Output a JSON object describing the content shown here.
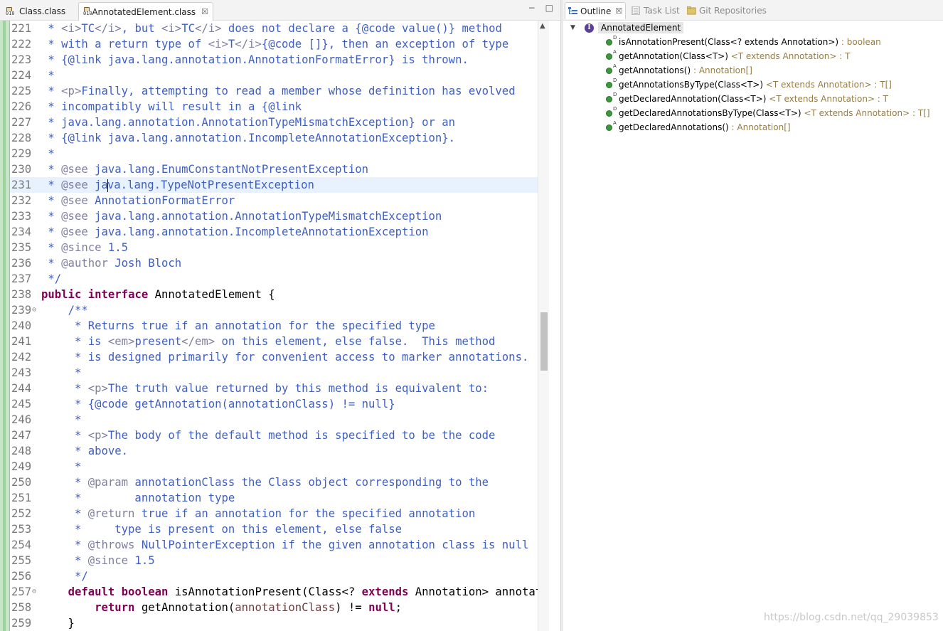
{
  "editor": {
    "tabs": [
      {
        "label": "Class.class",
        "icon": "class-file-icon"
      },
      {
        "label": "AnnotatedElement.class",
        "icon": "class-file-icon",
        "close": "☒"
      }
    ],
    "window_controls": {
      "minimize": "−",
      "maximize": "□"
    },
    "lines": [
      {
        "n": "221",
        "s": [
          [
            "cm",
            " * "
          ],
          [
            "tg",
            "<i>"
          ],
          [
            "cm",
            "TC"
          ],
          [
            "tg",
            "</i>"
          ],
          [
            "cm",
            ", but "
          ],
          [
            "tg",
            "<i>"
          ],
          [
            "cm",
            "TC"
          ],
          [
            "tg",
            "</i>"
          ],
          [
            "cm",
            " does not declare a {@code value()} method"
          ]
        ]
      },
      {
        "n": "222",
        "s": [
          [
            "cm",
            " * with a return type of "
          ],
          [
            "tg",
            "<i>"
          ],
          [
            "cm",
            "T"
          ],
          [
            "tg",
            "</i>"
          ],
          [
            "cm",
            "{@code []}, then an exception of type"
          ]
        ]
      },
      {
        "n": "223",
        "s": [
          [
            "cm",
            " * {@link java.lang.annotation.AnnotationFormatError} is thrown."
          ]
        ]
      },
      {
        "n": "224",
        "s": [
          [
            "cm",
            " *"
          ]
        ]
      },
      {
        "n": "225",
        "s": [
          [
            "cm",
            " * "
          ],
          [
            "tg",
            "<p>"
          ],
          [
            "cm",
            "Finally, attempting to read a member whose definition has evolved"
          ]
        ]
      },
      {
        "n": "226",
        "s": [
          [
            "cm",
            " * incompatibly will result in a {@link"
          ]
        ]
      },
      {
        "n": "227",
        "s": [
          [
            "cm",
            " * java.lang.annotation.AnnotationTypeMismatchException} or an"
          ]
        ]
      },
      {
        "n": "228",
        "s": [
          [
            "cm",
            " * {@link java.lang.annotation.IncompleteAnnotationException}."
          ]
        ]
      },
      {
        "n": "229",
        "s": [
          [
            "cm",
            " *"
          ]
        ]
      },
      {
        "n": "230",
        "s": [
          [
            "cm",
            " * "
          ],
          [
            "tg",
            "@see"
          ],
          [
            "cm",
            " java.lang.EnumConstantNotPresentException"
          ]
        ]
      },
      {
        "n": "231",
        "hl": true,
        "caret": true,
        "s": [
          [
            "cm",
            " * "
          ],
          [
            "tg",
            "@see"
          ],
          [
            "cm",
            " ja"
          ],
          [
            "caret",
            ""
          ],
          [
            "cm",
            "va.lang.TypeNotPresentException"
          ]
        ]
      },
      {
        "n": "232",
        "s": [
          [
            "cm",
            " * "
          ],
          [
            "tg",
            "@see"
          ],
          [
            "cm",
            " AnnotationFormatError"
          ]
        ]
      },
      {
        "n": "233",
        "s": [
          [
            "cm",
            " * "
          ],
          [
            "tg",
            "@see"
          ],
          [
            "cm",
            " java.lang.annotation.AnnotationTypeMismatchException"
          ]
        ]
      },
      {
        "n": "234",
        "s": [
          [
            "cm",
            " * "
          ],
          [
            "tg",
            "@see"
          ],
          [
            "cm",
            " java.lang.annotation.IncompleteAnnotationException"
          ]
        ]
      },
      {
        "n": "235",
        "s": [
          [
            "cm",
            " * "
          ],
          [
            "tg",
            "@since"
          ],
          [
            "cm",
            " 1.5"
          ]
        ]
      },
      {
        "n": "236",
        "s": [
          [
            "cm",
            " * "
          ],
          [
            "tg",
            "@author"
          ],
          [
            "cm",
            " Josh Bloch"
          ]
        ]
      },
      {
        "n": "237",
        "s": [
          [
            "cm",
            " */"
          ]
        ]
      },
      {
        "n": "238",
        "s": [
          [
            "kw",
            "public"
          ],
          [
            "pl",
            " "
          ],
          [
            "kw",
            "interface"
          ],
          [
            "pl",
            " AnnotatedElement {"
          ]
        ]
      },
      {
        "n": "239",
        "fold": "⊖",
        "s": [
          [
            "pl",
            "    "
          ],
          [
            "cm",
            "/**"
          ]
        ]
      },
      {
        "n": "240",
        "s": [
          [
            "cm",
            "     * Returns true if an annotation for the specified type"
          ]
        ]
      },
      {
        "n": "241",
        "s": [
          [
            "cm",
            "     * is "
          ],
          [
            "tg",
            "<em>"
          ],
          [
            "cm",
            "present"
          ],
          [
            "tg",
            "</em>"
          ],
          [
            "cm",
            " on this element, else false.  This method"
          ]
        ]
      },
      {
        "n": "242",
        "s": [
          [
            "cm",
            "     * is designed primarily for convenient access to marker annotations."
          ]
        ]
      },
      {
        "n": "243",
        "s": [
          [
            "cm",
            "     *"
          ]
        ]
      },
      {
        "n": "244",
        "s": [
          [
            "cm",
            "     * "
          ],
          [
            "tg",
            "<p>"
          ],
          [
            "cm",
            "The truth value returned by this method is equivalent to:"
          ]
        ]
      },
      {
        "n": "245",
        "s": [
          [
            "cm",
            "     * {@code getAnnotation(annotationClass) != null}"
          ]
        ]
      },
      {
        "n": "246",
        "s": [
          [
            "cm",
            "     *"
          ]
        ]
      },
      {
        "n": "247",
        "s": [
          [
            "cm",
            "     * "
          ],
          [
            "tg",
            "<p>"
          ],
          [
            "cm",
            "The body of the default method is specified to be the code"
          ]
        ]
      },
      {
        "n": "248",
        "s": [
          [
            "cm",
            "     * above."
          ]
        ]
      },
      {
        "n": "249",
        "s": [
          [
            "cm",
            "     *"
          ]
        ]
      },
      {
        "n": "250",
        "s": [
          [
            "cm",
            "     * "
          ],
          [
            "tg",
            "@param"
          ],
          [
            "cm",
            " annotationClass the Class object corresponding to the"
          ]
        ]
      },
      {
        "n": "251",
        "s": [
          [
            "cm",
            "     *        annotation type"
          ]
        ]
      },
      {
        "n": "252",
        "s": [
          [
            "cm",
            "     * "
          ],
          [
            "tg",
            "@return"
          ],
          [
            "cm",
            " true if an annotation for the specified annotation"
          ]
        ]
      },
      {
        "n": "253",
        "s": [
          [
            "cm",
            "     *     type is present on this element, else false"
          ]
        ]
      },
      {
        "n": "254",
        "s": [
          [
            "cm",
            "     * "
          ],
          [
            "tg",
            "@throws"
          ],
          [
            "cm",
            " NullPointerException if the given annotation class is null"
          ]
        ]
      },
      {
        "n": "255",
        "s": [
          [
            "cm",
            "     * "
          ],
          [
            "tg",
            "@since"
          ],
          [
            "cm",
            " 1.5"
          ]
        ]
      },
      {
        "n": "256",
        "s": [
          [
            "cm",
            "     */"
          ]
        ]
      },
      {
        "n": "257",
        "fold": "⊖",
        "s": [
          [
            "pl",
            "    "
          ],
          [
            "kw",
            "default"
          ],
          [
            "pl",
            " "
          ],
          [
            "kw",
            "boolean"
          ],
          [
            "pl",
            " isAnnotationPresent(Class<? "
          ],
          [
            "kw",
            "extends"
          ],
          [
            "pl",
            " Annotation> annotationClass) {"
          ]
        ]
      },
      {
        "n": "258",
        "s": [
          [
            "pl",
            "        "
          ],
          [
            "kw",
            "return"
          ],
          [
            "pl",
            " getAnnotation("
          ],
          [
            "pm",
            "annotationClass"
          ],
          [
            "pl",
            ") != "
          ],
          [
            "kw",
            "null"
          ],
          [
            "pl",
            ";"
          ]
        ]
      },
      {
        "n": "259",
        "s": [
          [
            "pl",
            "    }"
          ]
        ]
      }
    ],
    "scrollbar_up": "▲"
  },
  "outline": {
    "tabs": [
      {
        "label": "Outline",
        "close": "☒"
      },
      {
        "label": "Task List"
      },
      {
        "label": "Git Repositories"
      }
    ],
    "root": {
      "twisty": "▼",
      "icon_letter": "I",
      "label": "AnnotatedElement"
    },
    "items": [
      {
        "mod": "D",
        "name": "isAnnotationPresent(Class<? extends Annotation>)",
        "type": " : boolean"
      },
      {
        "mod": "A",
        "name": "getAnnotation(Class<T>)",
        "type": " <T extends Annotation> : T"
      },
      {
        "mod": "A",
        "name": "getAnnotations()",
        "type": " : Annotation[]"
      },
      {
        "mod": "D",
        "name": "getAnnotationsByType(Class<T>)",
        "type": " <T extends Annotation> : T[]"
      },
      {
        "mod": "D",
        "name": "getDeclaredAnnotation(Class<T>)",
        "type": " <T extends Annotation> : T"
      },
      {
        "mod": "D",
        "name": "getDeclaredAnnotationsByType(Class<T>)",
        "type": " <T extends Annotation> : T[]"
      },
      {
        "mod": "A",
        "name": "getDeclaredAnnotations()",
        "type": " : Annotation[]"
      }
    ]
  },
  "watermark": "https://blog.csdn.net/qq_29039853",
  "colors": {
    "comment": "#3f5fbf",
    "javadoc_tag": "#7f7f9f",
    "keyword": "#7f0055",
    "type_detail": "#957d47",
    "method_dot": "#3a9a3a"
  }
}
